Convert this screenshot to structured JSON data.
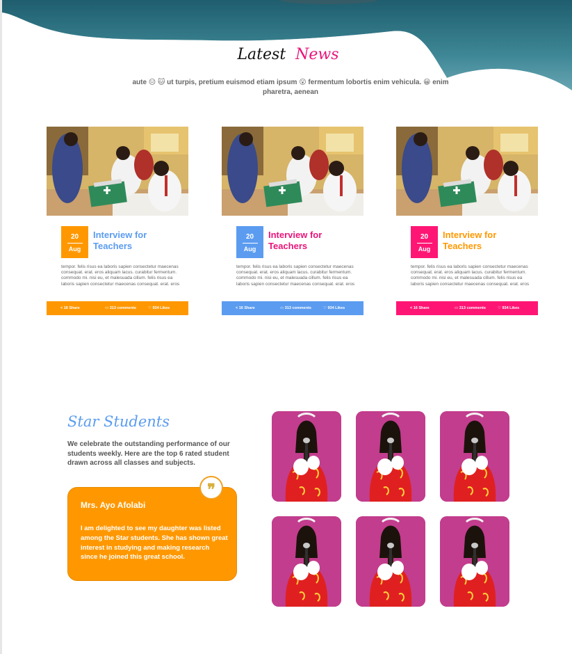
{
  "news": {
    "title_first": "Latest",
    "title_second": "News",
    "subtitle": "aute 😑 🐱 ut turpis, pretium euismod etiam ipsum 😮 fermentum lobortis enim vehicula. 😀 enim pharetra, aenean",
    "cards": [
      {
        "day": "20",
        "month": "Aug",
        "title": "Interview for Teachers",
        "body": "tempor. felis risus ea laboris sapien consectetur maecenas consequat. erat. eros aliquam lacus. curabitur fermentum. commodo mi. nisi eu, et malesuada cillum. felis risus ea laboris sapien consectetur maecenas consequat. erat. eros",
        "share": "< 16 Share",
        "comments": "313 comments",
        "likes": "934 Likes",
        "accent": "#ff9800",
        "title_color": "#5b9cf0"
      },
      {
        "day": "20",
        "month": "Aug",
        "title": "Interview for Teachers",
        "body": "tempor. felis risus ea laboris sapien consectetur maecenas consequat. erat. eros aliquam lacus. curabitur fermentum. commodo mi. nisi eu, et malesuada cillum. felis risus ea laboris sapien consectetur maecenas consequat. erat. eros",
        "share": "< 16 Share",
        "comments": "313 comments",
        "likes": "934 Likes",
        "accent": "#5b9cf0",
        "title_color": "#e8147a"
      },
      {
        "day": "20",
        "month": "Aug",
        "title": "Interview for Teachers",
        "body": "tempor. felis risus ea laboris sapien consectetur maecenas consequat. erat. eros aliquam lacus. curabitur fermentum. commodo mi. nisi eu, et malesuada cillum. felis risus ea laboris sapien consectetur maecenas consequat. erat. eros",
        "share": "< 16 Share",
        "comments": "313 comments",
        "likes": "934 Likes",
        "accent": "#ff1675",
        "title_color": "#ff9800"
      }
    ]
  },
  "stars": {
    "title": "Star Students",
    "description": "We celebrate the outstanding performance of our students weekly. Here are the top 6 rated student drawn across all classes and subjects.",
    "testimonial": {
      "name": "Mrs. Ayo Afolabi",
      "text": "I am delighted to see my daughter was listed among the Star students. She has shown great interest in studying and making research since he joined this great school."
    },
    "quote_icon": "quote-icon"
  },
  "colors": {
    "hero_dark": "#2b6f80",
    "orange": "#ff9800",
    "blue": "#5b9cf0",
    "pink": "#e8147a"
  }
}
